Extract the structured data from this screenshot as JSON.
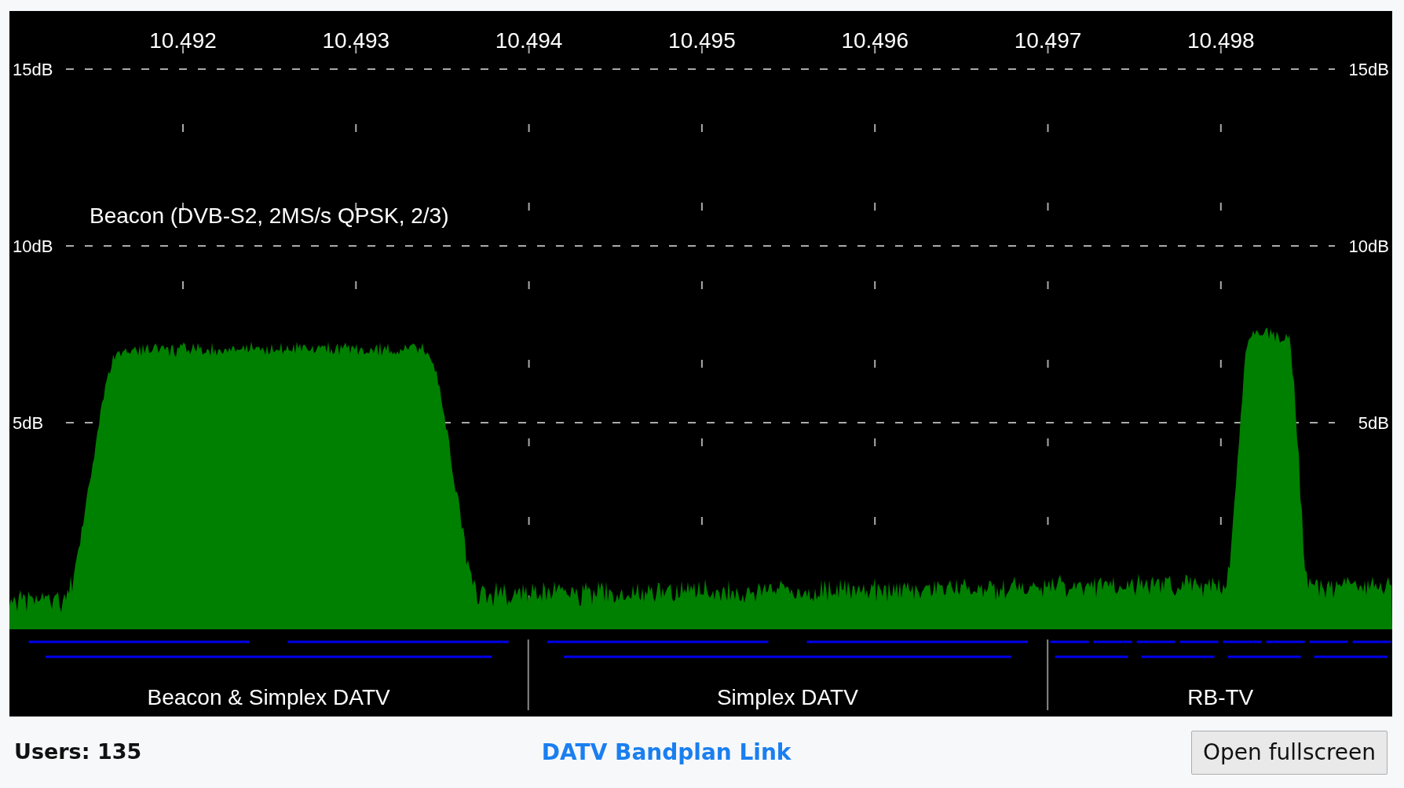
{
  "spectrum": {
    "frequency_labels": [
      "10.492",
      "10.493",
      "10.494",
      "10.495",
      "10.496",
      "10.497",
      "10.498"
    ],
    "level_labels_left": [
      "15dB",
      "10dB",
      "5dB"
    ],
    "level_labels_right": [
      "15dB",
      "10dB",
      "5dB"
    ],
    "annotation": "Beacon (DVB-S2, 2MS/s QPSK, 2/3)"
  },
  "bandplan": [
    {
      "label": "Beacon & Simplex DATV",
      "kind": "solid"
    },
    {
      "label": "Simplex DATV",
      "kind": "solid"
    },
    {
      "label": "RB-TV",
      "kind": "dashed"
    }
  ],
  "footer": {
    "users": "Users: 135",
    "link": "DATV Bandplan Link",
    "button": "Open fullscreen"
  }
}
